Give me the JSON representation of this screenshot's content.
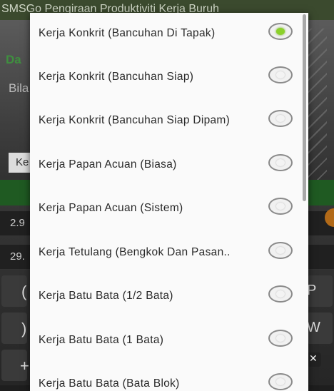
{
  "app": {
    "title": "SMSGo Pengiraan Produktiviti Kerja Buruh",
    "fragments": [
      "Da",
      "Bila",
      "Ke",
      "2.9",
      "29.",
      "(",
      ")",
      "+",
      "P",
      "W",
      "✕"
    ]
  },
  "dialog": {
    "options": [
      {
        "label": "Kerja Konkrit (Bancuhan Di Tapak)",
        "selected": true
      },
      {
        "label": "Kerja Konkrit (Bancuhan Siap)",
        "selected": false
      },
      {
        "label": "Kerja Konkrit (Bancuhan Siap Dipam)",
        "selected": false
      },
      {
        "label": "Kerja Papan Acuan (Biasa)",
        "selected": false
      },
      {
        "label": "Kerja Papan Acuan (Sistem)",
        "selected": false
      },
      {
        "label": "Kerja Tetulang (Bengkok Dan Pasan..",
        "selected": false
      },
      {
        "label": "Kerja Batu Bata (1/2 Bata)",
        "selected": false
      },
      {
        "label": "Kerja Batu Bata (1 Bata)",
        "selected": false
      },
      {
        "label": "Kerja Batu Bata (Bata Blok)",
        "selected": false
      }
    ]
  },
  "colors": {
    "selected_radio": "#8bd12a",
    "app_bar": "#3b4a2e",
    "green_bar": "#1f5a22"
  }
}
